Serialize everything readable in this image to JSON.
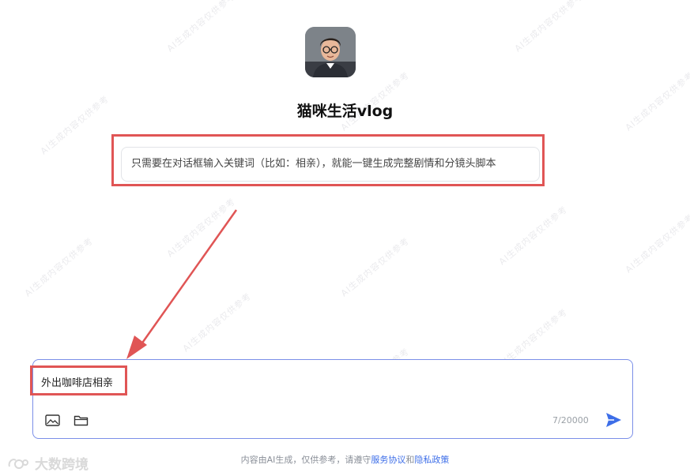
{
  "bot": {
    "name": "猫咪生活vlog",
    "avatar_icon": "avatar-person-glasses"
  },
  "hint": {
    "text": "只需要在对话框输入关键词（比如：相亲），就能一键生成完整剧情和分镜头脚本"
  },
  "composer": {
    "value": "外出咖啡店相亲",
    "char_count": "7/20000",
    "image_icon": "image-icon",
    "folder_icon": "folder-icon",
    "send_icon": "send-icon"
  },
  "footer": {
    "prefix": "内容由AI生成，仅供参考，请遵守",
    "service_link": "服务协议",
    "and": "和",
    "privacy_link": "隐私政策"
  },
  "watermark": {
    "brand_text": "大数跨境"
  },
  "colors": {
    "accent": "#3d6ee8",
    "annotation_red": "#e05555",
    "composer_border": "#7b8fe8"
  }
}
